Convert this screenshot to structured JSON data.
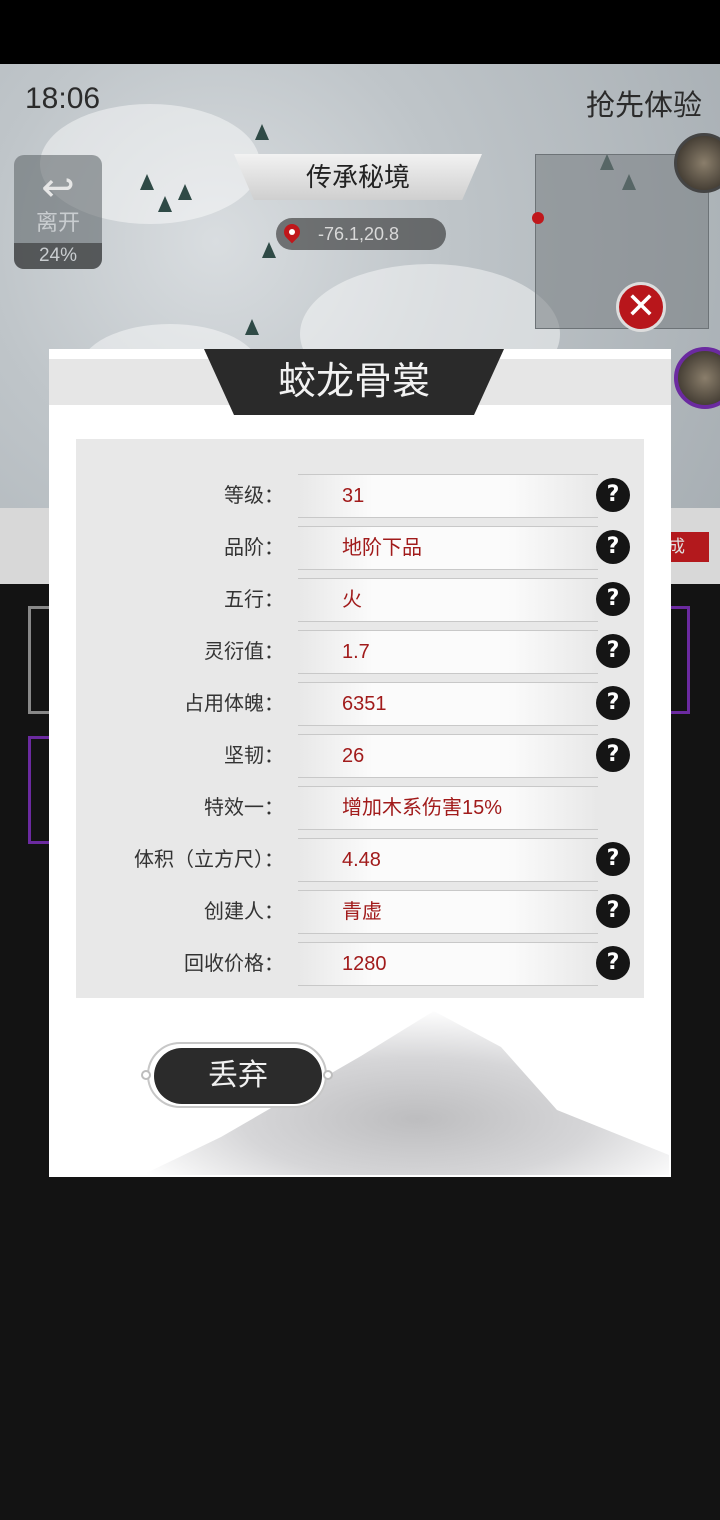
{
  "status": {
    "time": "18:06",
    "badge": "抢先体验"
  },
  "leave_button": {
    "label": "离开",
    "progress": "24%"
  },
  "realm": {
    "title": "传承秘境",
    "coords": "-76.1,20.8"
  },
  "background_tab": {
    "label": "成"
  },
  "dialog": {
    "title": "蛟龙骨裳",
    "rows": [
      {
        "key": "等级：",
        "value": "31",
        "help": true
      },
      {
        "key": "品阶：",
        "value": "地阶下品",
        "help": true
      },
      {
        "key": "五行：",
        "value": "火",
        "help": true
      },
      {
        "key": "灵衍值：",
        "value": "1.7",
        "help": true
      },
      {
        "key": "占用体魄：",
        "value": "6351",
        "help": true
      },
      {
        "key": "坚韧：",
        "value": "26",
        "help": true
      },
      {
        "key": "特效一：",
        "value": "增加木系伤害15%",
        "help": false
      },
      {
        "key": "体积（立方尺）：",
        "value": "4.48",
        "help": true
      },
      {
        "key": "创建人：",
        "value": "青虚",
        "help": true
      },
      {
        "key": "回收价格：",
        "value": "1280",
        "help": true
      }
    ],
    "help_glyph": "?",
    "discard_label": "丢弃"
  },
  "close_glyph": "✕",
  "colors": {
    "accent_red": "#a11b1b",
    "close_red": "#b8161b",
    "dark": "#2a2a2a",
    "purple_border": "#6b2aa0"
  }
}
